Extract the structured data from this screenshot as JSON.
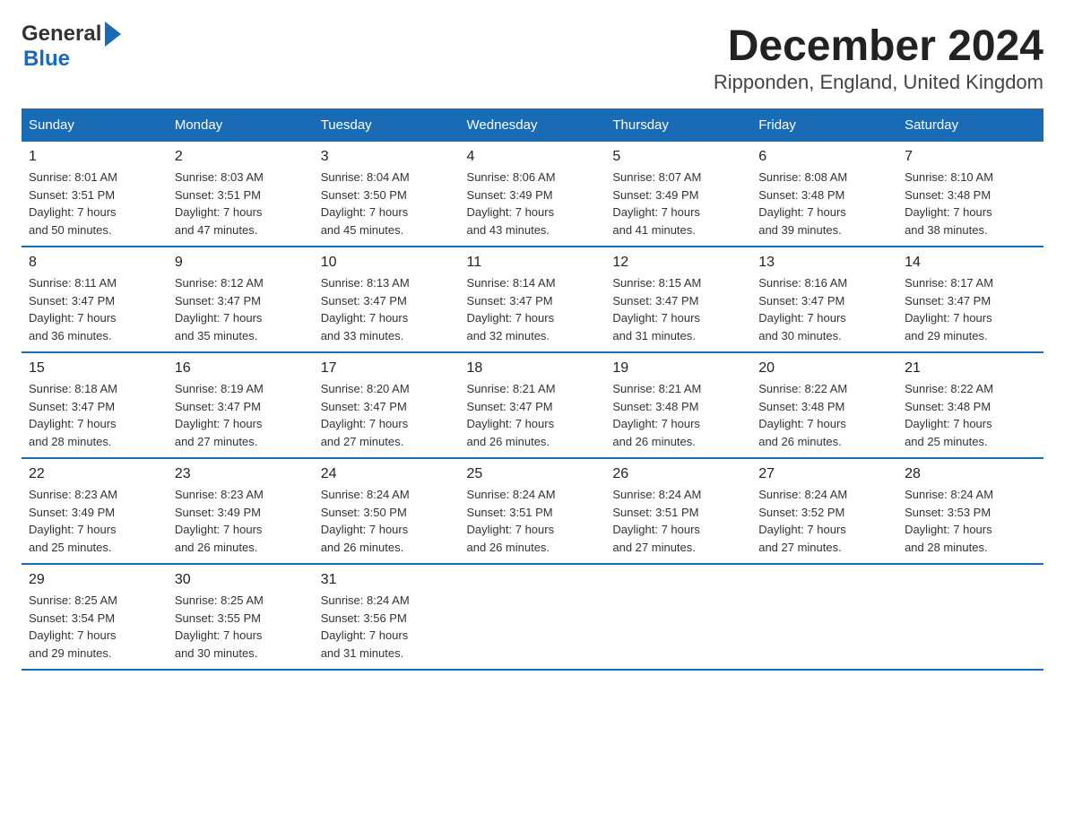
{
  "header": {
    "title": "December 2024",
    "subtitle": "Ripponden, England, United Kingdom"
  },
  "logo": {
    "line1": "General",
    "line2": "Blue"
  },
  "columns": [
    "Sunday",
    "Monday",
    "Tuesday",
    "Wednesday",
    "Thursday",
    "Friday",
    "Saturday"
  ],
  "weeks": [
    [
      {
        "day": "1",
        "sunrise": "Sunrise: 8:01 AM",
        "sunset": "Sunset: 3:51 PM",
        "daylight": "Daylight: 7 hours",
        "minutes": "and 50 minutes."
      },
      {
        "day": "2",
        "sunrise": "Sunrise: 8:03 AM",
        "sunset": "Sunset: 3:51 PM",
        "daylight": "Daylight: 7 hours",
        "minutes": "and 47 minutes."
      },
      {
        "day": "3",
        "sunrise": "Sunrise: 8:04 AM",
        "sunset": "Sunset: 3:50 PM",
        "daylight": "Daylight: 7 hours",
        "minutes": "and 45 minutes."
      },
      {
        "day": "4",
        "sunrise": "Sunrise: 8:06 AM",
        "sunset": "Sunset: 3:49 PM",
        "daylight": "Daylight: 7 hours",
        "minutes": "and 43 minutes."
      },
      {
        "day": "5",
        "sunrise": "Sunrise: 8:07 AM",
        "sunset": "Sunset: 3:49 PM",
        "daylight": "Daylight: 7 hours",
        "minutes": "and 41 minutes."
      },
      {
        "day": "6",
        "sunrise": "Sunrise: 8:08 AM",
        "sunset": "Sunset: 3:48 PM",
        "daylight": "Daylight: 7 hours",
        "minutes": "and 39 minutes."
      },
      {
        "day": "7",
        "sunrise": "Sunrise: 8:10 AM",
        "sunset": "Sunset: 3:48 PM",
        "daylight": "Daylight: 7 hours",
        "minutes": "and 38 minutes."
      }
    ],
    [
      {
        "day": "8",
        "sunrise": "Sunrise: 8:11 AM",
        "sunset": "Sunset: 3:47 PM",
        "daylight": "Daylight: 7 hours",
        "minutes": "and 36 minutes."
      },
      {
        "day": "9",
        "sunrise": "Sunrise: 8:12 AM",
        "sunset": "Sunset: 3:47 PM",
        "daylight": "Daylight: 7 hours",
        "minutes": "and 35 minutes."
      },
      {
        "day": "10",
        "sunrise": "Sunrise: 8:13 AM",
        "sunset": "Sunset: 3:47 PM",
        "daylight": "Daylight: 7 hours",
        "minutes": "and 33 minutes."
      },
      {
        "day": "11",
        "sunrise": "Sunrise: 8:14 AM",
        "sunset": "Sunset: 3:47 PM",
        "daylight": "Daylight: 7 hours",
        "minutes": "and 32 minutes."
      },
      {
        "day": "12",
        "sunrise": "Sunrise: 8:15 AM",
        "sunset": "Sunset: 3:47 PM",
        "daylight": "Daylight: 7 hours",
        "minutes": "and 31 minutes."
      },
      {
        "day": "13",
        "sunrise": "Sunrise: 8:16 AM",
        "sunset": "Sunset: 3:47 PM",
        "daylight": "Daylight: 7 hours",
        "minutes": "and 30 minutes."
      },
      {
        "day": "14",
        "sunrise": "Sunrise: 8:17 AM",
        "sunset": "Sunset: 3:47 PM",
        "daylight": "Daylight: 7 hours",
        "minutes": "and 29 minutes."
      }
    ],
    [
      {
        "day": "15",
        "sunrise": "Sunrise: 8:18 AM",
        "sunset": "Sunset: 3:47 PM",
        "daylight": "Daylight: 7 hours",
        "minutes": "and 28 minutes."
      },
      {
        "day": "16",
        "sunrise": "Sunrise: 8:19 AM",
        "sunset": "Sunset: 3:47 PM",
        "daylight": "Daylight: 7 hours",
        "minutes": "and 27 minutes."
      },
      {
        "day": "17",
        "sunrise": "Sunrise: 8:20 AM",
        "sunset": "Sunset: 3:47 PM",
        "daylight": "Daylight: 7 hours",
        "minutes": "and 27 minutes."
      },
      {
        "day": "18",
        "sunrise": "Sunrise: 8:21 AM",
        "sunset": "Sunset: 3:47 PM",
        "daylight": "Daylight: 7 hours",
        "minutes": "and 26 minutes."
      },
      {
        "day": "19",
        "sunrise": "Sunrise: 8:21 AM",
        "sunset": "Sunset: 3:48 PM",
        "daylight": "Daylight: 7 hours",
        "minutes": "and 26 minutes."
      },
      {
        "day": "20",
        "sunrise": "Sunrise: 8:22 AM",
        "sunset": "Sunset: 3:48 PM",
        "daylight": "Daylight: 7 hours",
        "minutes": "and 26 minutes."
      },
      {
        "day": "21",
        "sunrise": "Sunrise: 8:22 AM",
        "sunset": "Sunset: 3:48 PM",
        "daylight": "Daylight: 7 hours",
        "minutes": "and 25 minutes."
      }
    ],
    [
      {
        "day": "22",
        "sunrise": "Sunrise: 8:23 AM",
        "sunset": "Sunset: 3:49 PM",
        "daylight": "Daylight: 7 hours",
        "minutes": "and 25 minutes."
      },
      {
        "day": "23",
        "sunrise": "Sunrise: 8:23 AM",
        "sunset": "Sunset: 3:49 PM",
        "daylight": "Daylight: 7 hours",
        "minutes": "and 26 minutes."
      },
      {
        "day": "24",
        "sunrise": "Sunrise: 8:24 AM",
        "sunset": "Sunset: 3:50 PM",
        "daylight": "Daylight: 7 hours",
        "minutes": "and 26 minutes."
      },
      {
        "day": "25",
        "sunrise": "Sunrise: 8:24 AM",
        "sunset": "Sunset: 3:51 PM",
        "daylight": "Daylight: 7 hours",
        "minutes": "and 26 minutes."
      },
      {
        "day": "26",
        "sunrise": "Sunrise: 8:24 AM",
        "sunset": "Sunset: 3:51 PM",
        "daylight": "Daylight: 7 hours",
        "minutes": "and 27 minutes."
      },
      {
        "day": "27",
        "sunrise": "Sunrise: 8:24 AM",
        "sunset": "Sunset: 3:52 PM",
        "daylight": "Daylight: 7 hours",
        "minutes": "and 27 minutes."
      },
      {
        "day": "28",
        "sunrise": "Sunrise: 8:24 AM",
        "sunset": "Sunset: 3:53 PM",
        "daylight": "Daylight: 7 hours",
        "minutes": "and 28 minutes."
      }
    ],
    [
      {
        "day": "29",
        "sunrise": "Sunrise: 8:25 AM",
        "sunset": "Sunset: 3:54 PM",
        "daylight": "Daylight: 7 hours",
        "minutes": "and 29 minutes."
      },
      {
        "day": "30",
        "sunrise": "Sunrise: 8:25 AM",
        "sunset": "Sunset: 3:55 PM",
        "daylight": "Daylight: 7 hours",
        "minutes": "and 30 minutes."
      },
      {
        "day": "31",
        "sunrise": "Sunrise: 8:24 AM",
        "sunset": "Sunset: 3:56 PM",
        "daylight": "Daylight: 7 hours",
        "minutes": "and 31 minutes."
      },
      {
        "day": "",
        "sunrise": "",
        "sunset": "",
        "daylight": "",
        "minutes": ""
      },
      {
        "day": "",
        "sunrise": "",
        "sunset": "",
        "daylight": "",
        "minutes": ""
      },
      {
        "day": "",
        "sunrise": "",
        "sunset": "",
        "daylight": "",
        "minutes": ""
      },
      {
        "day": "",
        "sunrise": "",
        "sunset": "",
        "daylight": "",
        "minutes": ""
      }
    ]
  ]
}
